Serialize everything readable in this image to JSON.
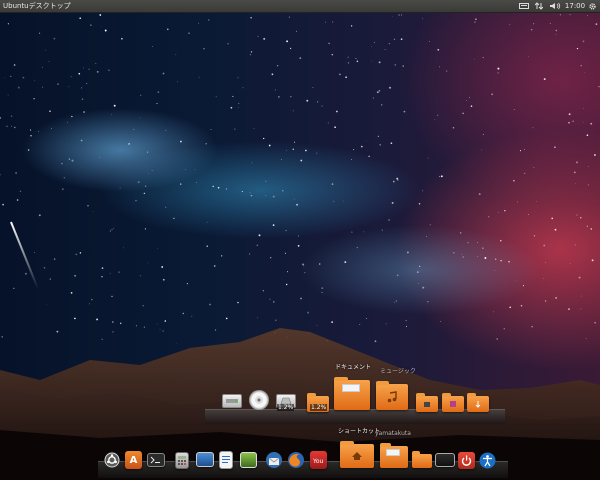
{
  "top_panel": {
    "title": "Ubuntuデスクトップ",
    "clock": "17:00",
    "indicators": [
      "keyboard-icon",
      "network-icon",
      "volume-icon",
      "session-gear-icon"
    ]
  },
  "dock": {
    "folder_shelf_labels": {
      "documents": "ドキュメント",
      "music": "ミュージック",
      "shortcuts": "ショートカット",
      "user": "yamatakuta"
    },
    "drive_usage": [
      "1.2%",
      "1.2%"
    ],
    "folder_shelf_icons": [
      "hard-drive-icon",
      "optical-disc-icon",
      "drive-icon",
      "folder-icon",
      "documents-folder-icon",
      "music-folder-icon",
      "downloads-folder-icon",
      "pictures-folder-icon",
      "videos-folder-icon",
      "public-folder-icon"
    ],
    "bottom_shelf_icons": [
      "ubuntu-icon",
      "software-center-icon",
      "terminal-icon",
      "calculator-icon",
      "system-monitor-icon",
      "writer-icon",
      "image-viewer-icon",
      "thunderbird-icon",
      "firefox-icon",
      "youtube-icon",
      "home-folder-icon",
      "documents-folder-icon",
      "desktop-folder-icon",
      "workspace-icon",
      "power-icon",
      "accessibility-icon"
    ]
  },
  "colors": {
    "folder_orange": "#e97a24",
    "panel": "#3c3b37",
    "power_red": "#d33a2c",
    "accessibility_blue": "#1b6fc4"
  }
}
